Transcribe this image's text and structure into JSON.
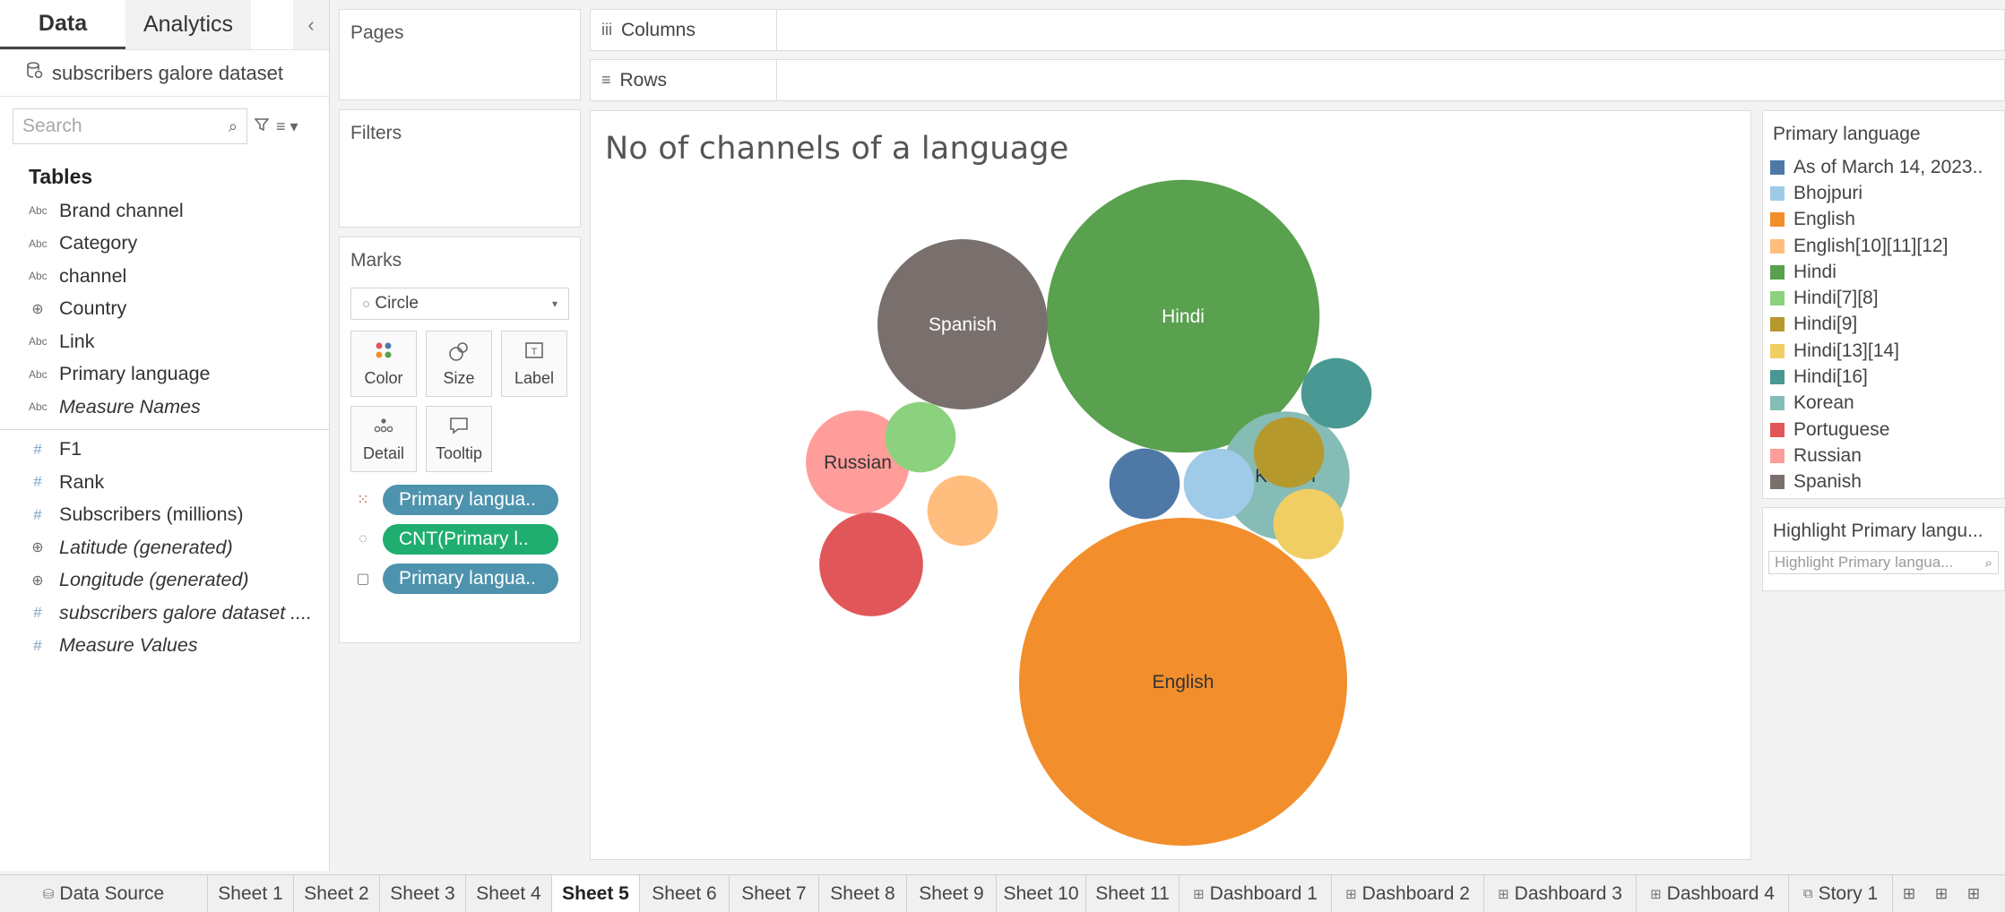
{
  "data_pane": {
    "tabs": [
      {
        "label": "Data",
        "active": true
      },
      {
        "label": "Analytics",
        "active": false
      }
    ],
    "collapse_glyph": "‹",
    "datasource": {
      "icon": "datasource-icon",
      "label": "subscribers galore dataset"
    },
    "search": {
      "placeholder": "Search",
      "value": ""
    },
    "tables_header": "Tables",
    "dimensions": [
      {
        "type": "Abc",
        "label": "Brand channel"
      },
      {
        "type": "Abc",
        "label": "Category"
      },
      {
        "type": "Abc",
        "label": "channel"
      },
      {
        "type": "globe",
        "label": "Country"
      },
      {
        "type": "Abc",
        "label": "Link"
      },
      {
        "type": "Abc",
        "label": "Primary language"
      },
      {
        "type": "Abc",
        "label": "Measure Names"
      }
    ],
    "measures": [
      {
        "type": "#",
        "label": "F1"
      },
      {
        "type": "#",
        "label": "Rank"
      },
      {
        "type": "#",
        "label": "Subscribers (millions)"
      },
      {
        "type": "globe",
        "label": "Latitude (generated)"
      },
      {
        "type": "globe",
        "label": "Longitude (generated)"
      },
      {
        "type": "#",
        "label": "subscribers galore dataset ...."
      },
      {
        "type": "#",
        "label": "Measure Values"
      }
    ]
  },
  "cards": {
    "pages_title": "Pages",
    "filters_title": "Filters",
    "marks_title": "Marks",
    "mark_type": "Circle",
    "mark_buttons": [
      {
        "label": "Color",
        "icon": "color-dots-icon"
      },
      {
        "label": "Size",
        "icon": "size-icon"
      },
      {
        "label": "Label",
        "icon": "label-icon"
      },
      {
        "label": "Detail",
        "icon": "detail-icon"
      },
      {
        "label": "Tooltip",
        "icon": "tooltip-icon"
      }
    ],
    "pills": [
      {
        "icon": "color-dots-icon",
        "label": "Primary langua..",
        "color": "#4e93ad"
      },
      {
        "icon": "size-icon",
        "label": "CNT(Primary l..",
        "color": "#1fae6f"
      },
      {
        "icon": "label-icon",
        "label": "Primary langua..",
        "color": "#4e93ad"
      }
    ]
  },
  "shelves": {
    "columns_label": "Columns",
    "rows_label": "Rows"
  },
  "view": {
    "title": "No of channels of a language"
  },
  "chart_data": {
    "type": "bubble",
    "title": "No of channels of a language",
    "size_encoding": "CNT(Primary language)",
    "color_encoding": "Primary language",
    "bubbles": [
      {
        "category": "English",
        "value": 13,
        "color": "#f28e2b",
        "label": "English"
      },
      {
        "category": "Hindi",
        "value": 9,
        "color": "#59a14f",
        "label": "Hindi"
      },
      {
        "category": "Spanish",
        "value": 3.5,
        "color": "#79706e",
        "label": "Spanish"
      },
      {
        "category": "Korean",
        "value": 2,
        "color": "#86bcb6",
        "label": "Korean"
      },
      {
        "category": "Russian",
        "value": 1.3,
        "color": "#ff9d9a",
        "label": "Russian"
      },
      {
        "category": "Portuguese",
        "value": 1.3,
        "color": "#e15759",
        "label": ""
      },
      {
        "category": "Hindi[7][8]",
        "value": 0.6,
        "color": "#8cd17d",
        "label": ""
      },
      {
        "category": "English[10][11][12]",
        "value": 0.6,
        "color": "#ffbe7d",
        "label": ""
      },
      {
        "category": "As of March 14, 2023..",
        "value": 0.6,
        "color": "#4e79a7",
        "label": ""
      },
      {
        "category": "Bhojpuri",
        "value": 0.6,
        "color": "#a0cbe8",
        "label": ""
      },
      {
        "category": "Hindi[9]",
        "value": 0.6,
        "color": "#b6992d",
        "label": ""
      },
      {
        "category": "Hindi[16]",
        "value": 0.6,
        "color": "#499894",
        "label": ""
      },
      {
        "category": "Hindi[13][14]",
        "value": 0.6,
        "color": "#f1ce63",
        "label": ""
      }
    ]
  },
  "legend": {
    "title": "Primary language",
    "items": [
      {
        "label": "As of March 14, 2023..",
        "color": "#4e79a7"
      },
      {
        "label": "Bhojpuri",
        "color": "#a0cbe8"
      },
      {
        "label": "English",
        "color": "#f28e2b"
      },
      {
        "label": "English[10][11][12]",
        "color": "#ffbe7d"
      },
      {
        "label": "Hindi",
        "color": "#59a14f"
      },
      {
        "label": "Hindi[7][8]",
        "color": "#8cd17d"
      },
      {
        "label": "Hindi[9]",
        "color": "#b6992d"
      },
      {
        "label": "Hindi[13][14]",
        "color": "#f1ce63"
      },
      {
        "label": "Hindi[16]",
        "color": "#499894"
      },
      {
        "label": "Korean",
        "color": "#86bcb6"
      },
      {
        "label": "Portuguese",
        "color": "#e15759"
      },
      {
        "label": "Russian",
        "color": "#ff9d9a"
      },
      {
        "label": "Spanish",
        "color": "#79706e"
      }
    ]
  },
  "highlighter": {
    "title": "Highlight Primary langu...",
    "placeholder": "Highlight Primary langua..."
  },
  "tab_bar": {
    "tabs": [
      {
        "label": "Data Source",
        "icon": "datasource-icon",
        "active": false
      },
      {
        "label": "Sheet 1",
        "icon": "",
        "active": false
      },
      {
        "label": "Sheet 2",
        "icon": "",
        "active": false
      },
      {
        "label": "Sheet 3",
        "icon": "",
        "active": false
      },
      {
        "label": "Sheet 4",
        "icon": "",
        "active": false
      },
      {
        "label": "Sheet 5",
        "icon": "",
        "active": true
      },
      {
        "label": "Sheet 6",
        "icon": "",
        "active": false
      },
      {
        "label": "Sheet 7",
        "icon": "",
        "active": false
      },
      {
        "label": "Sheet 8",
        "icon": "",
        "active": false
      },
      {
        "label": "Sheet 9",
        "icon": "",
        "active": false
      },
      {
        "label": "Sheet 10",
        "icon": "",
        "active": false
      },
      {
        "label": "Sheet 11",
        "icon": "",
        "active": false
      },
      {
        "label": "Dashboard 1",
        "icon": "dashboard-icon",
        "active": false
      },
      {
        "label": "Dashboard 2",
        "icon": "dashboard-icon",
        "active": false
      },
      {
        "label": "Dashboard 3",
        "icon": "dashboard-icon",
        "active": false
      },
      {
        "label": "Dashboard 4",
        "icon": "dashboard-icon",
        "active": false
      },
      {
        "label": "Story 1",
        "icon": "story-icon",
        "active": false
      }
    ],
    "tools": [
      "new-sheet-icon",
      "new-dashboard-icon",
      "new-story-icon"
    ]
  }
}
